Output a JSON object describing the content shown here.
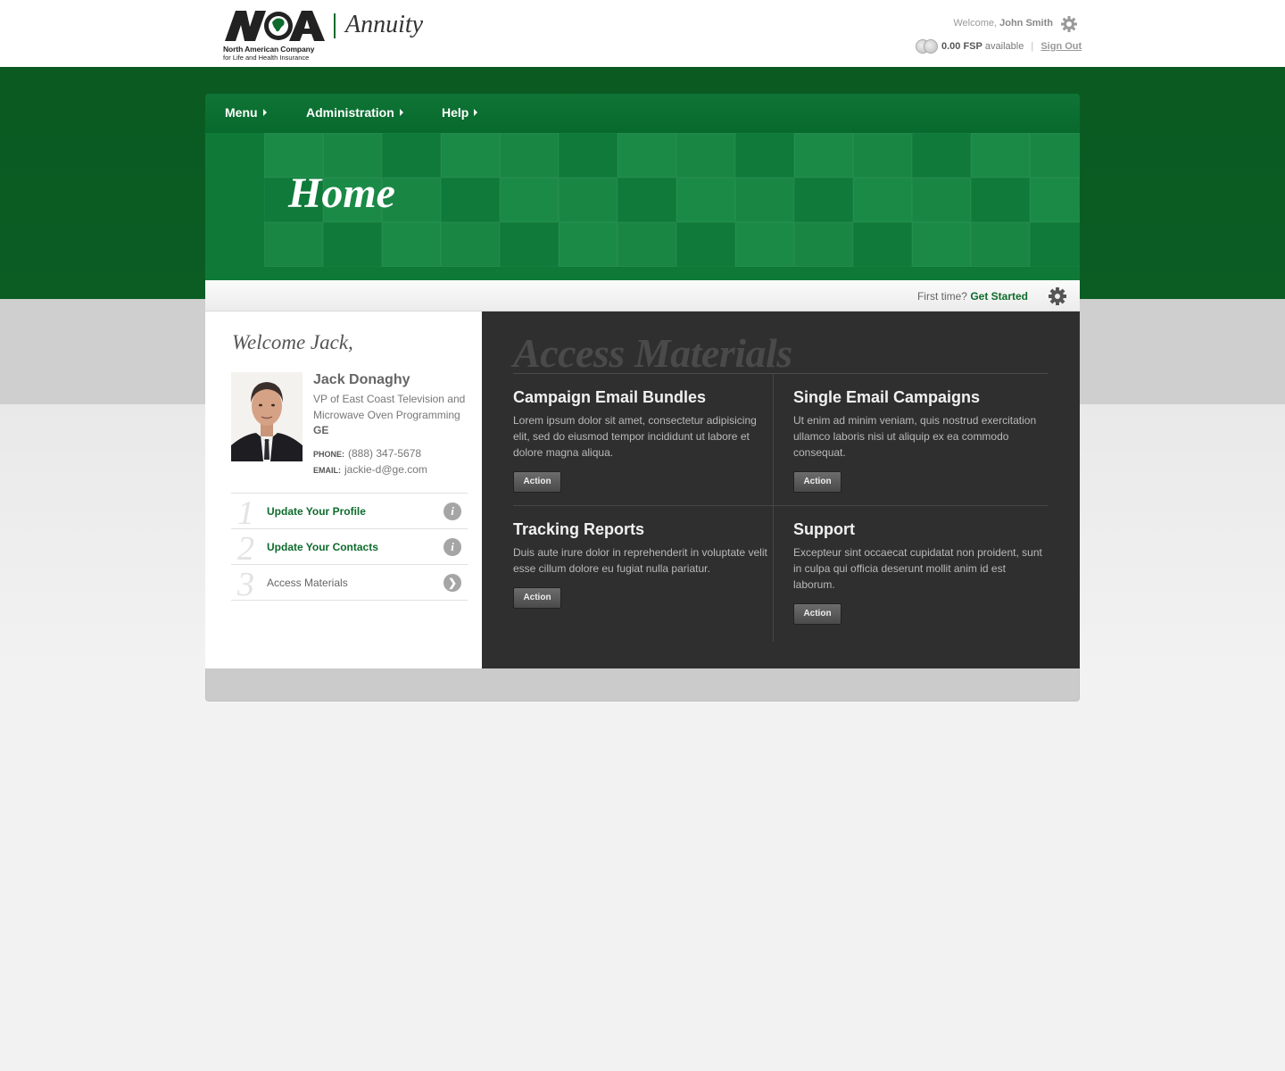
{
  "header": {
    "logo_name": "North American Company",
    "logo_sub": "for Life and Health Insurance",
    "product": "Annuity",
    "welcome_prefix": "Welcome,",
    "user_name": "John Smith",
    "fsp_amount": "0.00 FSP",
    "fsp_suffix": "available",
    "separator": "|",
    "sign_out": "Sign Out"
  },
  "nav": {
    "items": [
      {
        "label": "Menu"
      },
      {
        "label": "Administration"
      },
      {
        "label": "Help"
      }
    ]
  },
  "hero": {
    "title": "Home"
  },
  "subbar": {
    "prompt": "First time?",
    "link": "Get Started"
  },
  "profile": {
    "greeting": "Welcome Jack,",
    "name": "Jack Donaghy",
    "title": "VP of East Coast Television and Microwave Oven Programming",
    "company": "GE",
    "phone_label": "PHONE:",
    "phone": "(888) 347-5678",
    "email_label": "EMAIL:",
    "email": "jackie-d@ge.com"
  },
  "steps": [
    {
      "num": "1",
      "label": "Update Your Profile",
      "icon": "info-icon"
    },
    {
      "num": "2",
      "label": "Update Your Contacts",
      "icon": "info-icon"
    },
    {
      "num": "3",
      "label": "Access Materials",
      "icon": "chevron-right-icon"
    }
  ],
  "materials": {
    "title": "Access Materials",
    "cards": [
      {
        "title": "Campaign Email Bundles",
        "body": "Lorem ipsum dolor sit amet, consectetur adipisicing elit, sed do eiusmod tempor incididunt ut labore et dolore magna aliqua.",
        "action": "Action"
      },
      {
        "title": "Single Email Campaigns",
        "body": "Ut enim ad minim veniam, quis nostrud exercitation ullamco laboris nisi ut aliquip ex ea commodo consequat.",
        "action": "Action"
      },
      {
        "title": "Tracking Reports",
        "body": "Duis aute irure dolor in reprehenderit in voluptate velit esse cillum dolore eu fugiat nulla pariatur.",
        "action": "Action"
      },
      {
        "title": "Support",
        "body": "Excepteur sint occaecat cupidatat non proident, sunt in culpa qui officia deserunt mollit anim id est laborum.",
        "action": "Action"
      }
    ]
  },
  "colors": {
    "brand_green": "#0e6b2c",
    "dark_panel": "#2f2f2f"
  }
}
